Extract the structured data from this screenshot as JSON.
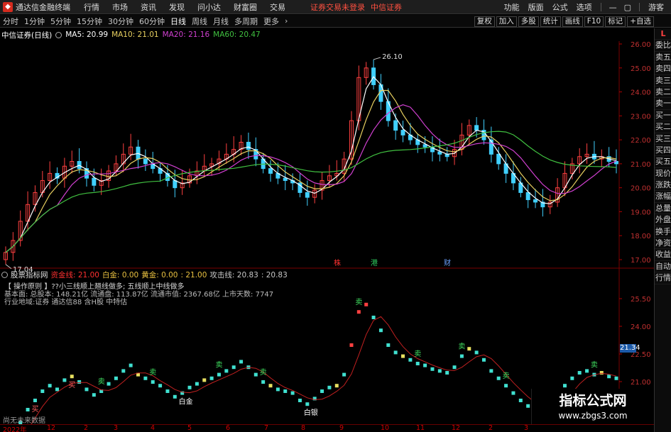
{
  "titlebar": {
    "app_title": "通达信金融终端",
    "menus": [
      "行情",
      "市场",
      "资讯",
      "发现",
      "问小达",
      "财富圈",
      "交易"
    ],
    "login_status": "证券交易未登录",
    "broker": "中信证券",
    "right_menus": [
      "功能",
      "版面",
      "公式",
      "选项"
    ],
    "guest": "游客"
  },
  "periodbar": {
    "periods": [
      "分时",
      "1分钟",
      "5分钟",
      "15分钟",
      "30分钟",
      "60分钟",
      "日线",
      "周线",
      "月线",
      "多周期",
      "更多"
    ],
    "active": "日线",
    "tools": [
      "复权",
      "加入",
      "多股",
      "统计",
      "画线",
      "F10",
      "标记",
      "+自选"
    ]
  },
  "right_tabs": [
    "L",
    "委比",
    "卖五",
    "卖四",
    "卖三",
    "卖二",
    "卖一",
    "买一",
    "买二",
    "买三",
    "买四",
    "买五",
    "现价",
    "涨跌",
    "涨幅",
    "总量",
    "外盘",
    "换手",
    "净资",
    "收益",
    "自动",
    "行情"
  ],
  "main": {
    "stock": "中信证券(日线)",
    "ma": [
      {
        "label": "MA5: 20.99",
        "color": "#ffffff"
      },
      {
        "label": "MA10: 21.01",
        "color": "#e8d060"
      },
      {
        "label": "MA20: 21.16",
        "color": "#d040d0"
      },
      {
        "label": "MA60: 20.47",
        "color": "#40c040"
      }
    ],
    "high_label": "26.10",
    "low_label": "17.04",
    "price_ticks": [
      "26.00",
      "25.00",
      "24.00",
      "23.00",
      "22.00",
      "21.00",
      "20.00",
      "19.00",
      "18.00",
      "17.00"
    ],
    "markers": [
      {
        "text": "株",
        "color": "#ff3030"
      },
      {
        "text": "港",
        "color": "#30d060"
      },
      {
        "text": "财",
        "color": "#6aa0ff"
      }
    ]
  },
  "sub": {
    "indicator": "股票指标网",
    "lines": [
      {
        "label": "资金线: 21.00",
        "color": "#ff3030"
      },
      {
        "label": "白金: 0.00",
        "color": "#e8c040"
      },
      {
        "label": "黄金: 0.00",
        "color": "#e8c040"
      },
      {
        "label": ": 21.00",
        "color": "#e8c040"
      },
      {
        "label": "攻击线: 20.83",
        "color": "#c8c8c8"
      },
      {
        "label": ": 20.83",
        "color": "#c8c8c8"
      }
    ],
    "info": [
      "【 操作原则 】??小三线顺上翘线做多; 五线顺上中线做多",
      "   基本面: 总股本: 148.21亿 流通盘: 113.87亿 流通市值: 2367.68亿 上市天数: 7747",
      "   行业地域:证券        通达信88 含H股  中特估"
    ],
    "price_ticks": [
      "25.50",
      "24.00",
      "22.50",
      "21.00",
      "19.50"
    ],
    "current_tag": "21.34",
    "signal_labels": [
      "白金",
      "白银",
      "白银",
      "买",
      "买",
      "买",
      "卖",
      "卖",
      "卖",
      "卖",
      "卖",
      "卖",
      "卖",
      "卖",
      "卖",
      "卖"
    ],
    "no_data": "尚无未来数据"
  },
  "date_axis": [
    "2022年",
    "12",
    "2",
    "3",
    "4",
    "5",
    "6",
    "7",
    "8",
    "9",
    "10",
    "11",
    "12",
    "2",
    "3"
  ],
  "watermark": {
    "title": "指标公式网",
    "url": "www.zbgs3.com"
  },
  "chart_data": {
    "type": "candlestick",
    "title": "中信证券(日线)",
    "ylim": [
      17.0,
      26.3
    ],
    "close": [
      17.3,
      17.8,
      18.6,
      19.3,
      19.8,
      20.3,
      20.6,
      20.4,
      20.9,
      21.1,
      20.8,
      20.4,
      20.1,
      20.3,
      20.7,
      21.0,
      21.4,
      21.7,
      21.2,
      21.0,
      20.8,
      20.6,
      20.3,
      20.0,
      20.2,
      20.5,
      20.7,
      20.9,
      21.0,
      21.2,
      21.4,
      21.6,
      21.9,
      21.6,
      21.2,
      20.8,
      20.6,
      20.4,
      20.3,
      20.2,
      19.8,
      19.6,
      19.9,
      20.3,
      20.5,
      20.6,
      21.2,
      22.8,
      24.6,
      25.0,
      24.3,
      23.6,
      22.8,
      22.4,
      22.2,
      22.0,
      21.8,
      21.7,
      21.5,
      21.4,
      21.3,
      21.6,
      22.2,
      22.6,
      22.4,
      22.0,
      21.4,
      21.0,
      20.6,
      20.2,
      19.8,
      19.5,
      19.4,
      19.2,
      19.4,
      20.0,
      20.6,
      21.0,
      21.3,
      21.4,
      21.2,
      21.3,
      21.1,
      21.0
    ],
    "series": [
      {
        "name": "MA5",
        "value": 20.99
      },
      {
        "name": "MA10",
        "value": 21.01
      },
      {
        "name": "MA20",
        "value": 21.16
      },
      {
        "name": "MA60",
        "value": 20.47
      }
    ]
  }
}
